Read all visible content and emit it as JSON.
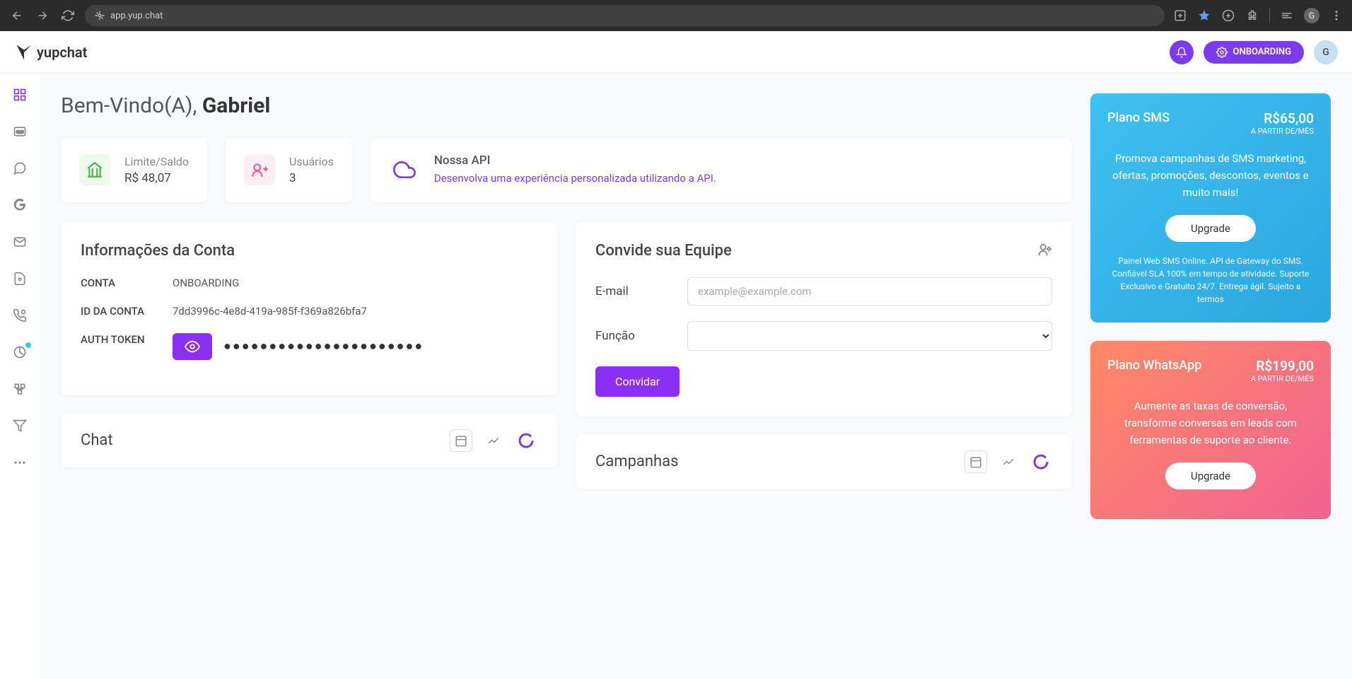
{
  "browser": {
    "url": "app.yup.chat",
    "profile_initial": "G"
  },
  "header": {
    "brand": "yupchat",
    "onboarding_label": "ONBOARDING",
    "avatar_initial": "G"
  },
  "welcome": {
    "prefix": "Bem-Vindo(A), ",
    "name": "Gabriel"
  },
  "stats": {
    "balance_label": "Limite/Saldo",
    "balance_value": "R$ 48,07",
    "users_label": "Usuários",
    "users_value": "3",
    "api_title": "Nossa API",
    "api_desc": "Desenvolva uma experiência personalizada utilizando a API."
  },
  "account": {
    "title": "Informações da Conta",
    "conta_label": "CONTA",
    "conta_value": "ONBOARDING",
    "id_label": "ID DA CONTA",
    "id_value": "7dd3996c-4e8d-419a-985f-f369a826bfa7",
    "token_label": "AUTH TOKEN",
    "token_masked": "●●●●●●●●●●●●●●●●●●●●●●"
  },
  "invite": {
    "title": "Convide sua Equipe",
    "email_label": "E-mail",
    "email_placeholder": "example@example.com",
    "role_label": "Função",
    "button": "Convidar"
  },
  "plans": {
    "sms": {
      "name": "Plano SMS",
      "price": "R$65,00",
      "price_sub": "A PARTIR DE/MÊS",
      "desc": "Promova campanhas de SMS marketing, ofertas, promoções, descontos, eventos e muito mais!",
      "btn": "Upgrade",
      "foot": "Painel Web SMS Online. API de Gateway do SMS. Confiável SLA 100% em tempo de atividade. Suporte Exclusivo e Gratuito 24/7. Entrega ágil. Sujeito a termos"
    },
    "whatsapp": {
      "name": "Plano WhatsApp",
      "price": "R$199,00",
      "price_sub": "A PARTIR DE/MÊS",
      "desc": "Aumente as taxas de conversão, transforme conversas em leads com ferramentas de suporte ao cliente.",
      "btn": "Upgrade"
    }
  },
  "widgets": {
    "chat": "Chat",
    "campanhas": "Campanhas"
  }
}
